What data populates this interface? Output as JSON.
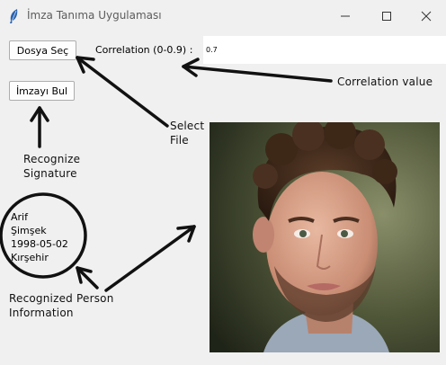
{
  "window": {
    "title": "İmza Tanıma Uygulaması",
    "icon": "feather-icon",
    "controls": [
      "minimize-icon",
      "maximize-icon",
      "close-icon"
    ]
  },
  "toolbar": {
    "file_button_label": "Dosya Seç",
    "find_button_label": "İmzayı Bul",
    "correlation_label": "Correlation (0-0.9) :",
    "correlation_value": "0.7"
  },
  "person": {
    "name": "Arif",
    "surname": "Şimşek",
    "birth_date": "1998-05-02",
    "city": "Kırşehir"
  },
  "annotations": {
    "correlation_note": "Correlation value",
    "select_note_line1": "Select",
    "select_note_line2": "File",
    "recognize_note_line1": "Recognize",
    "recognize_note_line2": "Signature",
    "info_note_line1": "Recognized Person",
    "info_note_line2": "Information"
  }
}
